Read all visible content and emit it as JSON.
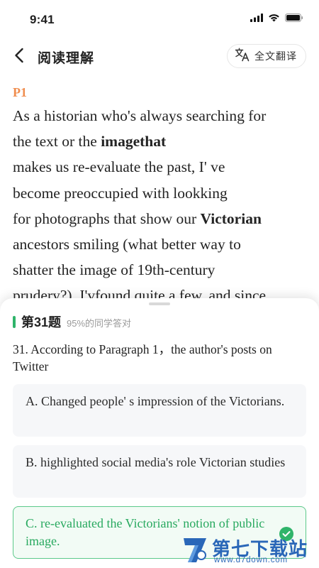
{
  "status_bar": {
    "time": "9:41"
  },
  "nav": {
    "title": "阅读理解",
    "translate_label": "全文翻译"
  },
  "passage": {
    "paragraph_label": "P1",
    "lines": [
      {
        "parts": [
          {
            "text": "As a historian who's always searching for",
            "bold": false
          }
        ]
      },
      {
        "parts": [
          {
            "text": "the text or the ",
            "bold": false
          },
          {
            "text": "imagethat",
            "bold": true
          }
        ]
      },
      {
        "parts": [
          {
            "text": "makes us re-evaluate the past, I' ve",
            "bold": false
          }
        ]
      },
      {
        "parts": [
          {
            "text": "become preoccupied with lookking",
            "bold": false
          }
        ]
      },
      {
        "parts": [
          {
            "text": "for photographs that show our ",
            "bold": false
          },
          {
            "text": "Victorian",
            "bold": true
          }
        ]
      },
      {
        "parts": [
          {
            "text": "ancestors smiling (what better way to",
            "bold": false
          }
        ]
      },
      {
        "parts": [
          {
            "text": "shatter the image of 19th-century",
            "bold": false
          }
        ]
      },
      {
        "parts": [
          {
            "text": "prudery?). I'vfound quite a few, and since",
            "bold": false
          }
        ]
      }
    ]
  },
  "question": {
    "number_label": "第31题",
    "stat": "95%的同学答对",
    "text": "31. According to Paragraph 1，the author's posts on Twitter",
    "options": [
      {
        "text": "A. Changed people' s impression of the Victorians.",
        "state": "default"
      },
      {
        "text": "B. highlighted social media's role Victorian studies",
        "state": "default"
      },
      {
        "text": "C. re-evaluated the Victorians' notion of public image.",
        "state": "correct"
      }
    ]
  },
  "watermark": {
    "name": "第七下载站",
    "url": "www.d7down.com"
  },
  "colors": {
    "accent_orange": "#f08d4e",
    "correct_green": "#2fb46a",
    "watermark_blue": "#2a67b8"
  }
}
